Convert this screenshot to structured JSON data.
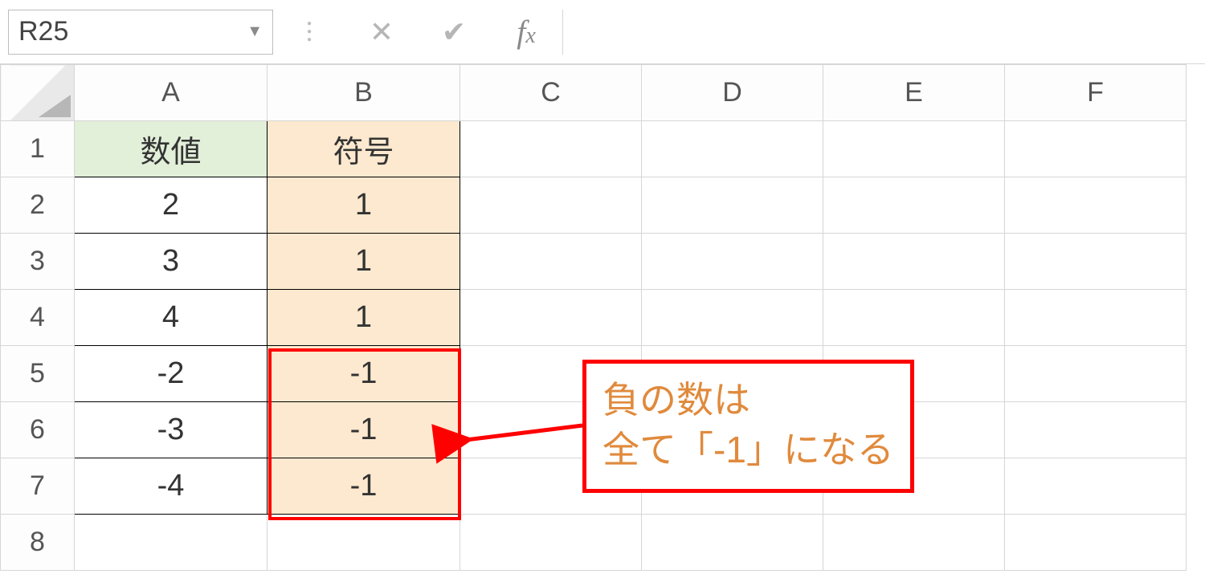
{
  "formula_bar": {
    "name_box": "R25",
    "formula": ""
  },
  "columns": [
    "A",
    "B",
    "C",
    "D",
    "E",
    "F"
  ],
  "rows": [
    "1",
    "2",
    "3",
    "4",
    "5",
    "6",
    "7",
    "8"
  ],
  "headers": {
    "A": "数値",
    "B": "符号"
  },
  "cells": {
    "A2": "2",
    "B2": "1",
    "A3": "3",
    "B3": "1",
    "A4": "4",
    "B4": "1",
    "A5": "-2",
    "B5": "-1",
    "A6": "-3",
    "B6": "-1",
    "A7": "-4",
    "B7": "-1"
  },
  "callout": {
    "line1": "負の数は",
    "line2": "全て「-1」になる"
  }
}
